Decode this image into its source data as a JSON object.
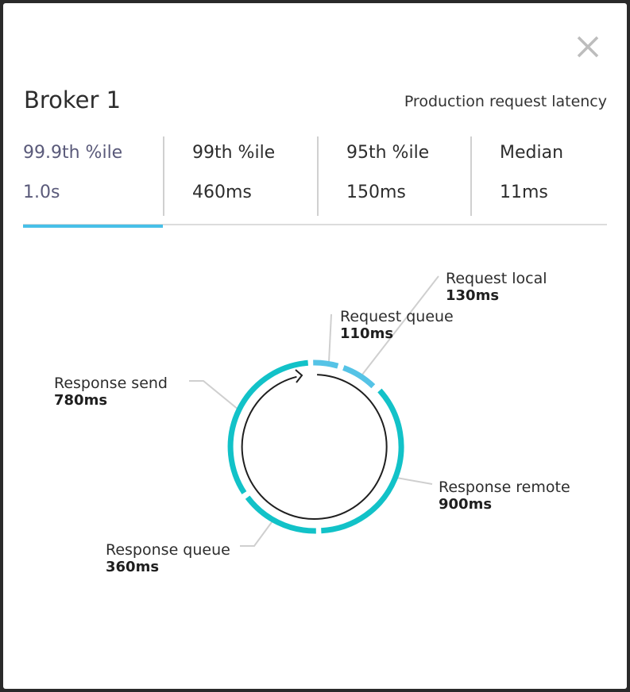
{
  "header": {
    "title": "Broker 1",
    "subtitle": "Production request latency"
  },
  "stats": [
    {
      "label": "99.9th %ile",
      "value": "1.0s",
      "active": true
    },
    {
      "label": "99th %ile",
      "value": "460ms",
      "active": false
    },
    {
      "label": "95th %ile",
      "value": "150ms",
      "active": false
    },
    {
      "label": "Median",
      "value": "11ms",
      "active": false
    }
  ],
  "segments": {
    "request_local": {
      "name": "Request local",
      "value": "130ms"
    },
    "request_queue": {
      "name": "Request queue",
      "value": "110ms"
    },
    "response_send": {
      "name": "Response send",
      "value": "780ms"
    },
    "response_remote": {
      "name": "Response remote",
      "value": "900ms"
    },
    "response_queue": {
      "name": "Response queue",
      "value": "360ms"
    }
  },
  "colors": {
    "primary_segment": "#12c2c8",
    "request_segment": "#55c3e6",
    "active_tab_underline": "#48c0e8",
    "leader_line": "#cfcfcf"
  },
  "icons": {
    "close": "close-icon"
  }
}
